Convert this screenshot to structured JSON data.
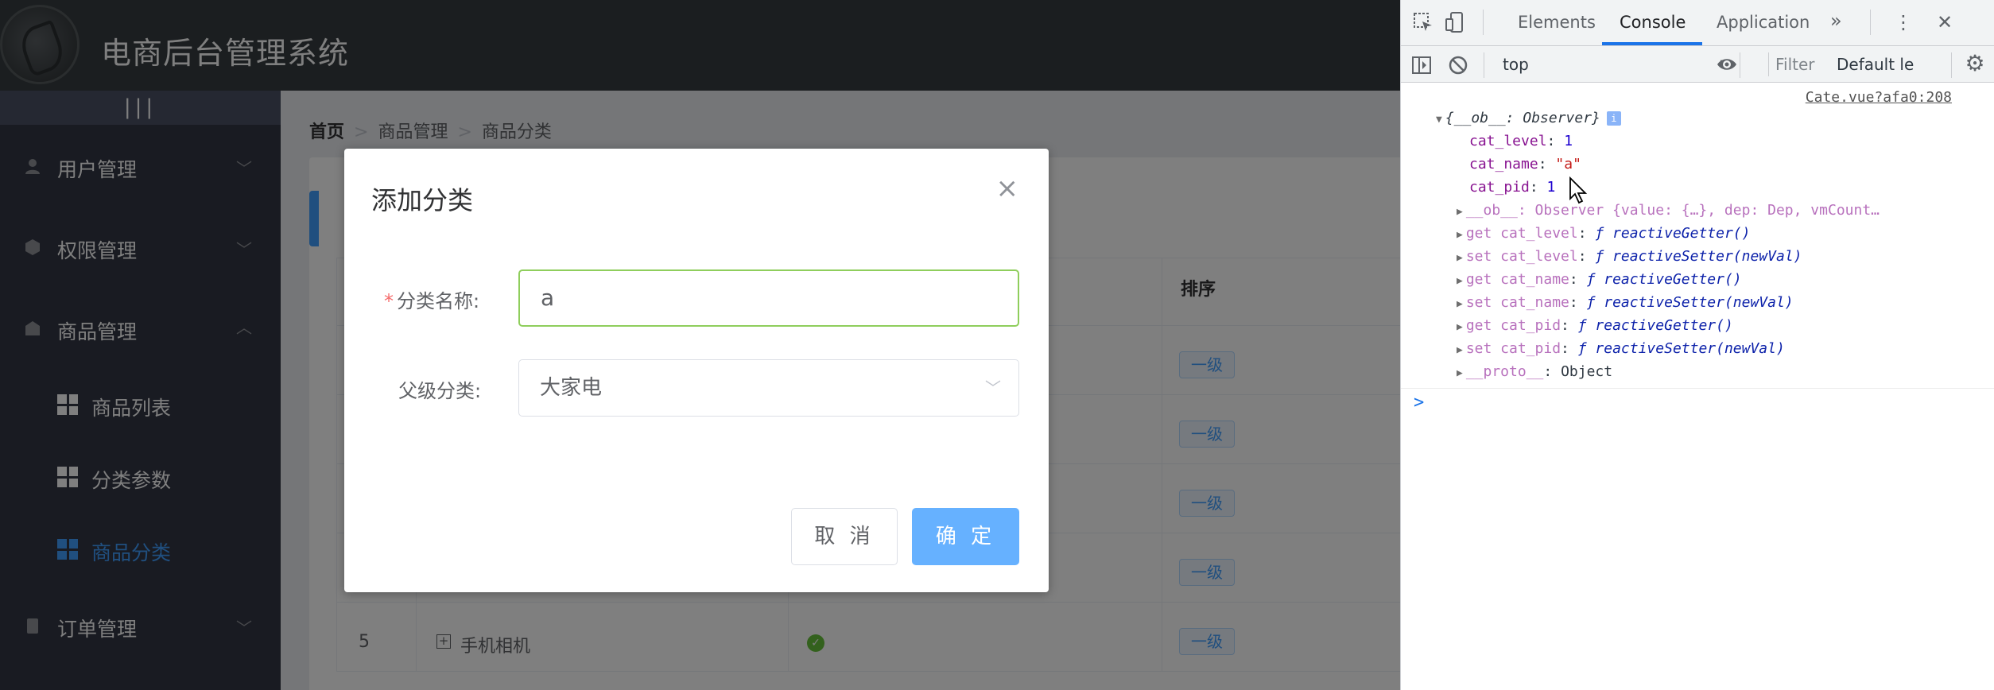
{
  "app": {
    "title": "电商后台管理系统",
    "toggle": "|||",
    "menu": [
      {
        "label": "用户管理",
        "icon": "user-icon",
        "arrow": "﹀"
      },
      {
        "label": "权限管理",
        "icon": "rights-icon",
        "arrow": "﹀"
      },
      {
        "label": "商品管理",
        "icon": "goods-icon",
        "arrow": "︿"
      },
      {
        "label": "商品列表",
        "icon": "grid-icon"
      },
      {
        "label": "分类参数",
        "icon": "grid-icon"
      },
      {
        "label": "商品分类",
        "icon": "grid-icon",
        "active": true
      },
      {
        "label": "订单管理",
        "icon": "order-icon",
        "arrow": "﹀"
      }
    ],
    "breadcrumb": [
      "首页",
      "商品管理",
      "商品分类"
    ],
    "breadcrumb_sep": ">",
    "table": {
      "col_sort": "排序",
      "tag": "一级",
      "last_row": {
        "index": "5",
        "name": "手机相机"
      }
    },
    "accent": "#409eff"
  },
  "dialog": {
    "title": "添加分类",
    "close": "×",
    "name_label": "分类名称:",
    "required_mark": "*",
    "name_value": "a",
    "parent_label": "父级分类:",
    "parent_value": "大家电",
    "cancel": "取 消",
    "ok": "确 定"
  },
  "devtools": {
    "tabs": [
      "Elements",
      "Console",
      "Application",
      "»"
    ],
    "context": "top",
    "filter_placeholder": "Filter",
    "levels": "Default le",
    "source_link": "Cate.vue?afa0:208",
    "object_header": "{__ob__: Observer}",
    "props": [
      {
        "key": "cat_level",
        "value": "1",
        "type": "num"
      },
      {
        "key": "cat_name",
        "value": "\"a\"",
        "type": "str"
      },
      {
        "key": "cat_pid",
        "value": "1",
        "type": "num"
      }
    ],
    "ob_line": "__ob__: Observer {value: {…}, dep: Dep, vmCount…",
    "accessors": [
      {
        "key": "get cat_level",
        "fn": "ƒ reactiveGetter()"
      },
      {
        "key": "set cat_level",
        "fn": "ƒ reactiveSetter(newVal)"
      },
      {
        "key": "get cat_name",
        "fn": "ƒ reactiveGetter()"
      },
      {
        "key": "set cat_name",
        "fn": "ƒ reactiveSetter(newVal)"
      },
      {
        "key": "get cat_pid",
        "fn": "ƒ reactiveGetter()"
      },
      {
        "key": "set cat_pid",
        "fn": "ƒ reactiveSetter(newVal)"
      }
    ],
    "proto_key": "__proto__",
    "proto_val": "Object",
    "prompt": ">"
  }
}
